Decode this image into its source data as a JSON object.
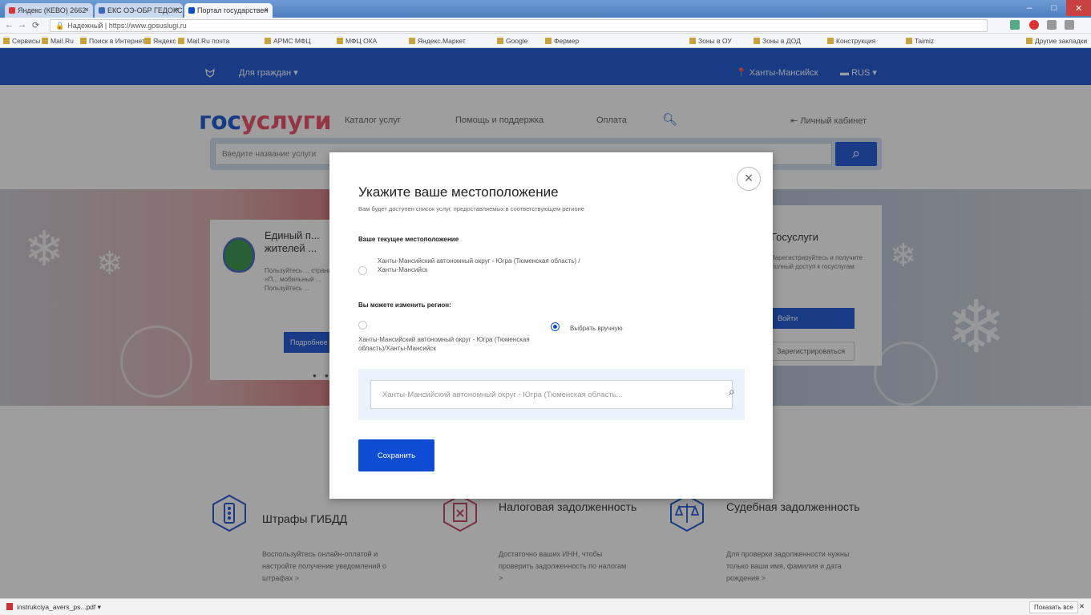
{
  "browser": {
    "tabs": [
      {
        "label": "Яндекс (КЕВО) 2662"
      },
      {
        "label": "ЕКС ОЭ-ОБР ГЕДОКС"
      },
      {
        "label": "Портал государствен"
      }
    ],
    "url": "Надежный | https://www.gosuslugi.ru",
    "bookmarks": [
      "Сервисы",
      "Mail.Ru",
      "Поиск в Интернете",
      "Яндекс",
      "Mail.Ru почта",
      "АРМС МФЦ",
      "МФЦ ОКА",
      "Яндекс.Маркет",
      "Google",
      "Фермер",
      "Зоны в ОУ",
      "Зоны в ДОД",
      "Конструкция",
      "Taimiz",
      "Другие закладки"
    ]
  },
  "topnav": {
    "who": "Для граждан",
    "location": "Ханты-Мансийск",
    "lang": "RUS"
  },
  "header": {
    "logo_part1": "гос",
    "logo_part2": "услуги",
    "menu": [
      "Каталог услуг",
      "Помощь и поддержка",
      "Оплата"
    ],
    "personal": "Личный кабинет",
    "search_placeholder": "Введите название услуги"
  },
  "banner": {
    "left_title": "Единый п... жителей ...",
    "left_text": "Пользуйтесь ... страницы «П... мобильный ... Пользуйтесь ...",
    "left_button": "Подробнее",
    "right_title": "Госуслуги",
    "right_text": "Зарегистрируйтесь и получите полный доступ к госуслугам",
    "right_button": "Войти",
    "right_button2": "Зарегистрироваться"
  },
  "services": [
    {
      "title": "Штрафы ГИБДД",
      "text": "Воспользуйтесь онлайн-оплатой и настройте получение уведомлений о штрафах >"
    },
    {
      "title": "Налоговая задолженность",
      "text": "Достаточно ваших ИНН, чтобы проверить задолженность по налогам >"
    },
    {
      "title": "Судебная задолженность",
      "text": "Для проверки задолженности нужны только ваши имя, фамилия и дата рождения >"
    }
  ],
  "modal": {
    "title": "Укажите ваше местоположение",
    "subtitle": "Вам будет доступен список услуг, предоставляемых в соответствующем регионе",
    "current_heading": "Ваше текущее местоположение",
    "current_value": "Ханты-Мансийский автономный округ - Югра (Тюменская область) / Ханты-Мансийск",
    "change_heading": "Вы можете изменить регион:",
    "option_auto": "Ханты-Мансийский автономный округ - Югра (Тюменская область)/Ханты-Мансийск",
    "option_manual": "Выбрать вручную",
    "region_input": "Ханты-Мансийский автономный округ - Югра (Тюменская область...",
    "save_label": "Сохранить"
  },
  "downloads": {
    "item": "instrukciya_avers_ps...pdf",
    "show_all": "Показать все"
  },
  "colors": {
    "brand_blue": "#0d4cd3",
    "brand_red": "#ee3f58"
  }
}
